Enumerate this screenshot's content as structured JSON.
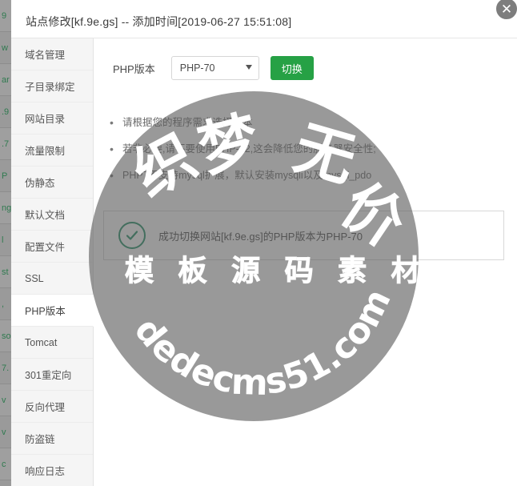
{
  "window": {
    "title": "站点修改[kf.9e.gs] -- 添加时间[2019-06-27 15:51:08]",
    "close_label": "✕"
  },
  "background_rows": [
    "9",
    "w",
    "ar",
    ".9",
    ".7",
    "P",
    "ng",
    "l",
    "st",
    ",",
    "so",
    "7.",
    "v",
    "v",
    "c"
  ],
  "sidebar": {
    "items": [
      {
        "label": "域名管理",
        "active": false
      },
      {
        "label": "子目录绑定",
        "active": false
      },
      {
        "label": "网站目录",
        "active": false
      },
      {
        "label": "流量限制",
        "active": false
      },
      {
        "label": "伪静态",
        "active": false
      },
      {
        "label": "默认文档",
        "active": false
      },
      {
        "label": "配置文件",
        "active": false
      },
      {
        "label": "SSL",
        "active": false
      },
      {
        "label": "PHP版本",
        "active": true
      },
      {
        "label": "Tomcat",
        "active": false
      },
      {
        "label": "301重定向",
        "active": false
      },
      {
        "label": "反向代理",
        "active": false
      },
      {
        "label": "防盗链",
        "active": false
      },
      {
        "label": "响应日志",
        "active": false
      }
    ]
  },
  "main": {
    "php_label": "PHP版本",
    "php_selected": "PHP-70",
    "php_options": [
      "PHP-70"
    ],
    "switch_button": "切换",
    "notes": [
      "请根据您的程序需求选择版本",
      "若非必要,请不要使用PHP-52,这会降低您的服务器安全性;",
      "PHP7不支持mysql扩展，默认安装mysqli以及mysql_pdo"
    ],
    "alert": {
      "icon": "check-circle-icon",
      "text": "成功切换网站[kf.9e.gs]的PHP版本为PHP-70"
    }
  },
  "watermark": {
    "char1": "织",
    "char2": "梦",
    "char3": "无",
    "char4": "价",
    "subtitle": "模 板 源 码 素 材",
    "domain": "dedecms51.com"
  },
  "colors": {
    "accent_green": "#26a145",
    "check_green": "#1f8f64",
    "sidebar_bg": "#f5f5f5",
    "overlay": "#5a5a5a"
  }
}
